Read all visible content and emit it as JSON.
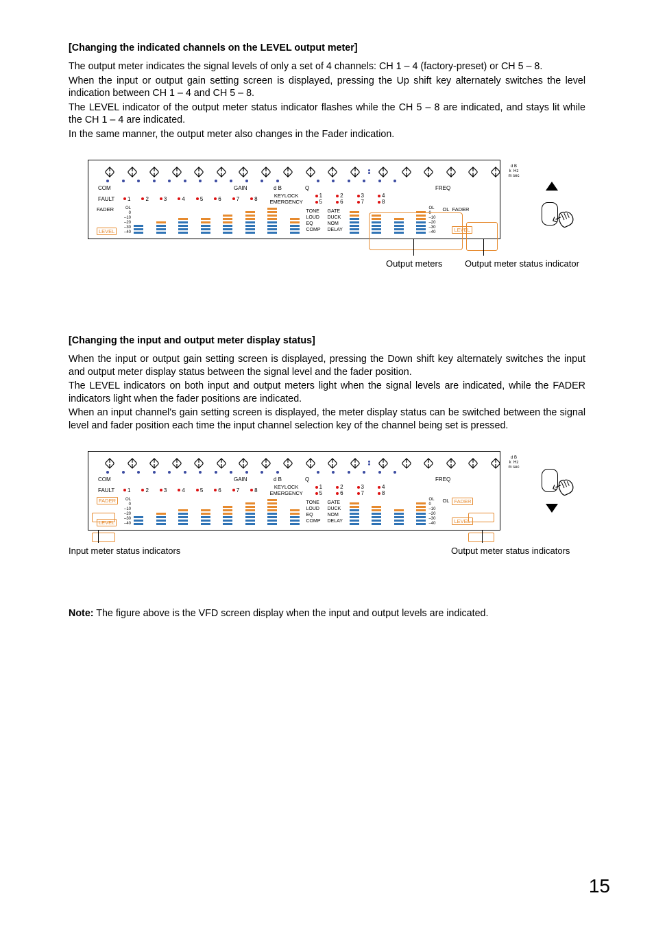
{
  "section1": {
    "title": "[Changing the indicated channels on the LEVEL output meter]",
    "p1": "The output meter indicates the signal levels of only a set of 4 channels: CH 1 – 4 (factory-preset) or CH 5 – 8.",
    "p2": "When the input or output gain setting screen is displayed, pressing the Up shift key alternately switches the level indication between CH 1 – 4 and CH 5 – 8.",
    "p3": "The LEVEL indicator of the output meter status indicator flashes while the CH 5 – 8 are indicated, and stays lit while the CH 1 – 4 are indicated.",
    "p4": "In the same manner, the output meter also changes in the Fader indication."
  },
  "section2": {
    "title": "[Changing the input and output meter display status]",
    "p1": "When the input or output gain setting screen is displayed, pressing the Down shift key alternately switches the input and output meter display status between the signal level and the fader position.",
    "p2": "The LEVEL indicators on both input and output meters light when the signal levels are indicated, while the FADER indicators light when the fader positions are indicated.",
    "p3": "When an input channel's gain setting screen is displayed, the meter display status can be switched between the signal level and fader position each time the input channel selection key of the channel being set is pressed."
  },
  "panel": {
    "header_labels": {
      "com": "COM",
      "gain": "GAIN",
      "db": "d B",
      "q": "Q",
      "freq": "FREQ"
    },
    "units": {
      "db": "d B",
      "k": "k",
      "hz": "Hz",
      "m": "m",
      "sec": "sec"
    },
    "fault_row": {
      "fault": "FAULT",
      "keylock": "KEYLOCK",
      "emergency": "EMERGENCY",
      "in_ch": [
        "1",
        "2",
        "3",
        "4",
        "5",
        "6",
        "7",
        "8"
      ],
      "out_ch_top": [
        "1",
        "2",
        "3",
        "4"
      ],
      "out_ch_bot": [
        "5",
        "6",
        "7",
        "8"
      ]
    },
    "ticks": {
      "ol": "OL",
      "t0": "0",
      "t10": "–10",
      "t20": "–20",
      "t30": "–30",
      "t40": "–40"
    },
    "left": {
      "fader": "FADER",
      "level": "LEVEL",
      "ol": "OL"
    },
    "right": {
      "fader": "FADER",
      "level": "LEVEL",
      "ol": "OL"
    },
    "proc": [
      "TONE",
      "GATE",
      "LOUD",
      "DUCK",
      "EQ",
      "NOM",
      "COMP",
      "DELAY"
    ]
  },
  "fig1": {
    "callout_meters": "Output meters",
    "callout_indicator": "Output meter status indicator"
  },
  "fig2": {
    "callout_left": "Input meter status indicators",
    "callout_right": "Output meter status indicators"
  },
  "note": {
    "bold": "Note:",
    "text": " The figure above is the VFD screen display when the input and output levels are indicated."
  },
  "page_number": "15"
}
